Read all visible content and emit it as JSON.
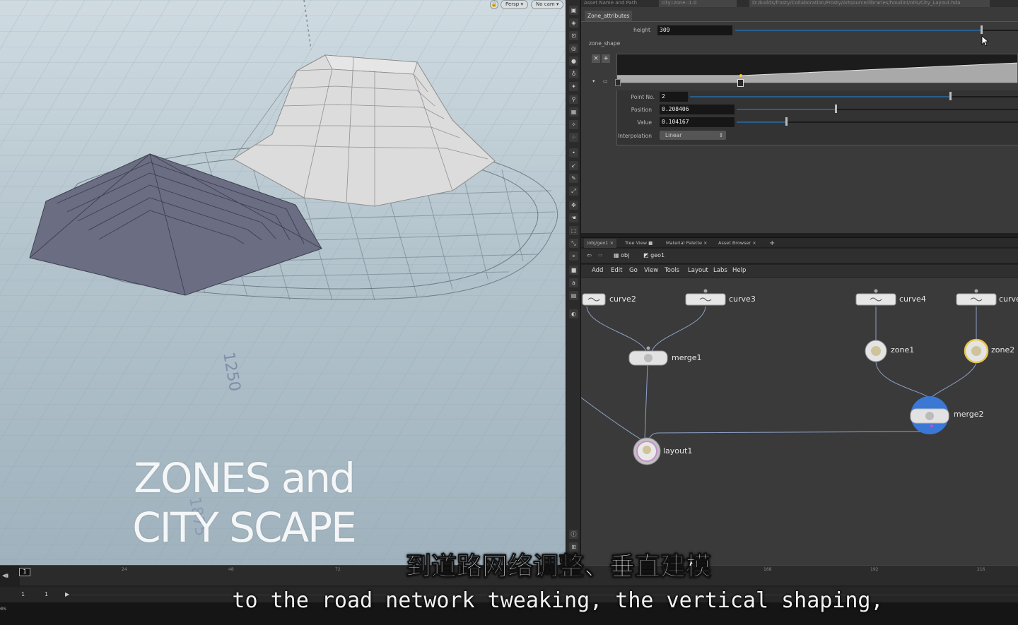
{
  "viewport": {
    "camera_persp": "Persp ▾",
    "camera_cam": "No cam ▾",
    "grid_label_a": "1250",
    "grid_label_b": "1875",
    "title_line1": "ZONES and",
    "title_line2": "CITY SCAPE"
  },
  "params": {
    "header_label": "Asset Name and Path",
    "asset_name": "city::zone::1.0",
    "asset_path": "D:/builds/frosty/Collaboration/Frosty/Artsource/libraries/houdini/otls/City_Layout.hda",
    "tab": "Zone_attributes",
    "height_label": "height",
    "height_value": "309",
    "zone_shape_label": "zone_shape",
    "point_no_label": "Point No.",
    "point_no_value": "2",
    "position_label": "Position",
    "position_value": "0.208406",
    "value_label": "Value",
    "value_value": "0.104167",
    "interp_label": "Interpolation",
    "interp_value": "Linear"
  },
  "network": {
    "tabs": [
      "/obj/geo1",
      "Tree View",
      "Material Palette",
      "Asset Browser"
    ],
    "path_obj": "obj",
    "path_geo": "geo1",
    "menu": [
      "Add",
      "Edit",
      "Go",
      "View",
      "Tools",
      "Layout",
      "Labs",
      "Help"
    ],
    "nodes": {
      "curve2": "curve2",
      "curve3": "curve3",
      "curve4": "curve4",
      "curve5": "curve",
      "merge1": "merge1",
      "zone1": "zone1",
      "zone2": "zone2",
      "merge2": "merge2",
      "layout1": "layout1"
    }
  },
  "timeline": {
    "current_frame": "1",
    "ticks": [
      "24",
      "48",
      "72",
      "168",
      "192",
      "216"
    ],
    "start": "1",
    "end": "1",
    "status": "es"
  },
  "subtitles": {
    "cn": "到道路网络调整、垂直建模",
    "en": "to the road network tweaking, the vertical shaping,"
  }
}
